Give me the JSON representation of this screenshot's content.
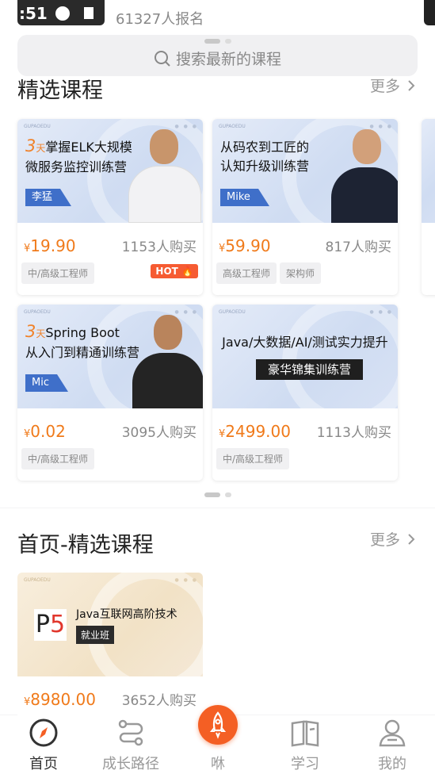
{
  "prev_card": {
    "time_fragment": ":51",
    "enrolled": "61327人报名"
  },
  "search": {
    "placeholder": "搜索最新的课程",
    "icon": "search-icon"
  },
  "featured": {
    "title": "精选课程",
    "more_label": "更多",
    "courses": [
      {
        "num": "3",
        "day": "天",
        "title_line1": "掌握ELK大规模",
        "title_line2": "微服务监控训练营",
        "teacher": "李猛",
        "price": "19.90",
        "sold": "1153人购买",
        "tags": [
          "中/高级工程师"
        ],
        "badge": "HOT"
      },
      {
        "title_line1": "从码农到工匠的",
        "title_line2": "认知升级训练营",
        "teacher": "Mike",
        "price": "59.90",
        "sold": "817人购买",
        "tags": [
          "高级工程师",
          "架构师"
        ]
      },
      {
        "num": "3",
        "day": "天",
        "title_line1": "Spring Boot",
        "title_line2": "从入门到精通训练营",
        "teacher": "Mic",
        "price": "0.02",
        "sold": "3095人购买",
        "tags": [
          "中/高级工程师"
        ]
      },
      {
        "title_line1": "Java/大数据/AI/测试实力提升",
        "title_line2": "豪华锦集训练营",
        "price": "2499.00",
        "sold": "1113人购买",
        "tags": [
          "中/高级工程师"
        ]
      }
    ],
    "brand_mark": "GUPAOEDU",
    "currency": "¥"
  },
  "homepage_featured": {
    "title": "首页-精选课程",
    "more_label": "更多",
    "course": {
      "logo_p": "P",
      "logo_num": "5",
      "title": "Java互联网高阶技术",
      "pill": "就业班",
      "price": "8980.00",
      "sold": "3652人购买"
    }
  },
  "tabbar": {
    "items": [
      {
        "label": "首页",
        "icon": "compass-icon",
        "active": true
      },
      {
        "label": "成长路径",
        "icon": "path-icon"
      },
      {
        "label": "咻",
        "icon": "rocket-icon"
      },
      {
        "label": "学习",
        "icon": "book-icon"
      },
      {
        "label": "我的",
        "icon": "user-icon"
      }
    ]
  },
  "colors": {
    "accent": "#f45f24",
    "price": "#f07a1a",
    "tag_blue": "#3f6fc9"
  }
}
